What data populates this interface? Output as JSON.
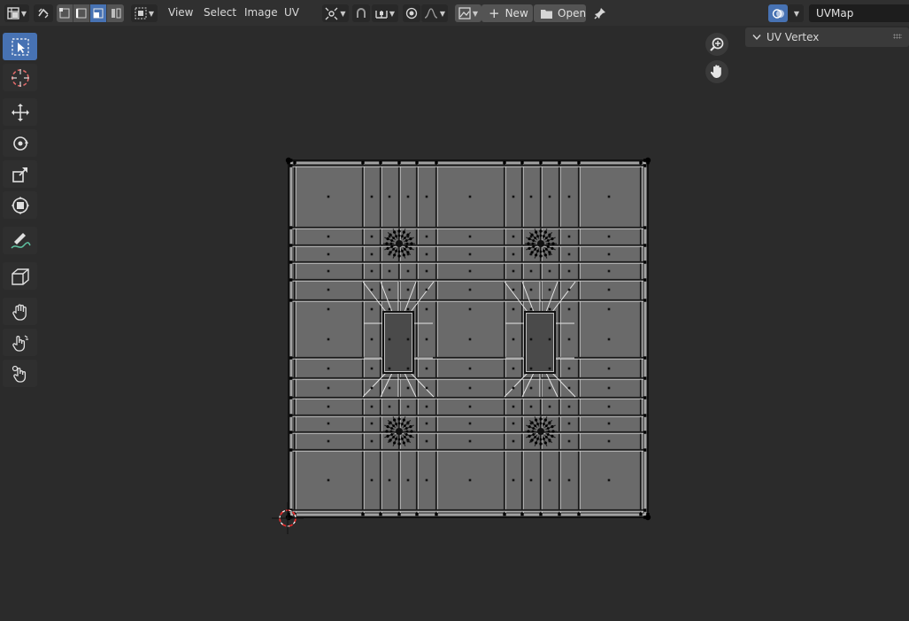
{
  "header": {
    "editor_type_icon": "uv-editor-icon",
    "sync_icon": "uv-sync-selection-icon",
    "select_modes": [
      "vertex-select-icon",
      "edge-select-icon",
      "face-select-icon",
      "island-select-icon"
    ],
    "active_select_mode": 2,
    "sticky_mode_icon": "sticky-selection-icon",
    "menus": [
      "View",
      "Select",
      "Image",
      "UV"
    ],
    "pivot_icon": "pivot-point-icon",
    "snap_icon": "snap-icon",
    "snap_target_icon": "snap-increment-icon",
    "proportional_icon": "proportional-editing-icon",
    "falloff_icon": "falloff-curve-icon",
    "image_browse_icon": "image-browse-icon",
    "new_label": "New",
    "open_label": "Open",
    "pin_icon": "pin-icon",
    "overlay_icon": "overlays-icon",
    "uvmap_value": "UVMap"
  },
  "toolbar": {
    "tools": [
      "select-box-icon",
      "cursor-icon",
      "move-icon",
      "rotate-icon",
      "scale-icon",
      "transform-icon",
      "annotate-icon",
      "rip-region-icon",
      "grab-icon",
      "relax-icon",
      "pinch-icon"
    ],
    "active_tool": 0
  },
  "navigation": {
    "zoom_icon": "zoom-icon",
    "pan_icon": "pan-hand-icon"
  },
  "sidebar": {
    "panel_title": "UV Vertex"
  },
  "colors": {
    "background": "#2b2b2b",
    "header": "#303030",
    "accent": "#4772b3",
    "uv_face": "#646464",
    "cursor": "#e02b2b"
  }
}
